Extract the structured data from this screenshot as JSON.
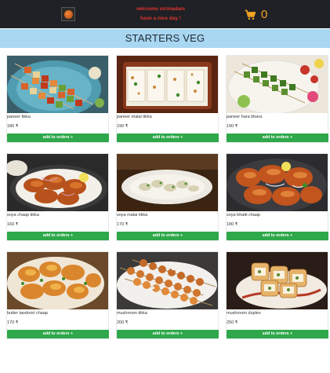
{
  "header": {
    "logo_icon": "restaurant-logo",
    "welcome_line1": "welcome sir/madam",
    "welcome_line2": "have a nice day !",
    "cart_icon": "shopping-cart-icon",
    "cart_count": "0",
    "accent_color": "#f5a623",
    "welcome_color": "#e0342c"
  },
  "section": {
    "title": "STARTERS VEG"
  },
  "items": [
    {
      "name": "paneer tikka",
      "price": "180 ₹",
      "button": "add to orders +"
    },
    {
      "name": "paneer malai tikka",
      "price": "190 ₹",
      "button": "add to orders +"
    },
    {
      "name": "paneer hara bhara",
      "price": "190 ₹",
      "button": "add to orders +"
    },
    {
      "name": "soya chaap tikka",
      "price": "160 ₹",
      "button": "add to orders +"
    },
    {
      "name": "soya malai tikka",
      "price": "170 ₹",
      "button": "add to orders +"
    },
    {
      "name": "soya bhatti chaap",
      "price": "180 ₹",
      "button": "add to orders +"
    },
    {
      "name": "butter tandoori chaap",
      "price": "170 ₹",
      "button": "add to orders +"
    },
    {
      "name": "mushroom tikka",
      "price": "200 ₹",
      "button": "add to orders +"
    },
    {
      "name": "mushroom duplex",
      "price": "250 ₹",
      "button": "add to orders +"
    }
  ],
  "colors": {
    "button": "#2ea84a",
    "section_bg": "#a9d6f1",
    "topbar_bg": "#1f2126"
  }
}
